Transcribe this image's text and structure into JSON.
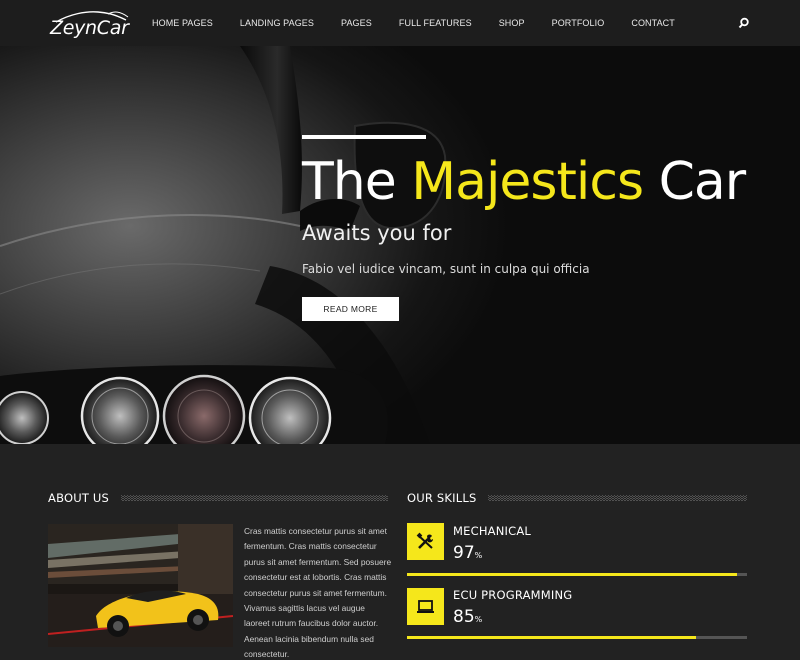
{
  "brand": {
    "name": "ZeynCar"
  },
  "nav": {
    "items": [
      "HOME PAGES",
      "LANDING PAGES",
      "PAGES",
      "FULL FEATURES",
      "SHOP",
      "PORTFOLIO",
      "CONTACT"
    ],
    "search_icon": "search-icon"
  },
  "hero": {
    "title_prefix": "The",
    "title_accent": "Majestics",
    "title_suffix": "Car",
    "subtitle": "Awaits you for",
    "text": "Fabio vel iudice vincam, sunt in culpa qui officia",
    "button": "READ MORE"
  },
  "about": {
    "title": "ABOUT US",
    "text": "Cras mattis consectetur purus sit amet fermentum. Cras mattis consectetur purus sit amet fermentum. Sed posuere consectetur est at lobortis. Cras mattis consectetur purus sit amet fermentum. Vivamus sagittis lacus vel augue laoreet rutrum faucibus dolor auctor. Aenean lacinia bibendum nulla sed consectetur."
  },
  "skills": {
    "title": "OUR SKILLS",
    "items": [
      {
        "name": "MECHANICAL",
        "value": "97",
        "unit": "%",
        "percent": 97,
        "icon": "tools-icon"
      },
      {
        "name": "ECU PROGRAMMING",
        "value": "85",
        "unit": "%",
        "percent": 85,
        "icon": "laptop-icon"
      }
    ]
  },
  "colors": {
    "accent": "#f5e71b",
    "nav_bg": "#1d1d1d",
    "page_bg": "#222222"
  }
}
